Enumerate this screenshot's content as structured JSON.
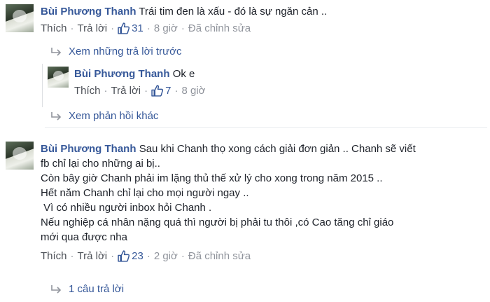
{
  "comments": [
    {
      "author": "Bùi Phương Thanh",
      "lines": [
        "Trái tim đen là xấu - đó là sự ngăn cản .."
      ],
      "meta": {
        "like": "Thích",
        "reply": "Trả lời",
        "likes": "31",
        "time": "8 giờ",
        "edited": "Đã chỉnh sửa"
      }
    },
    {
      "author": "Bùi Phương Thanh",
      "lines": [
        "Ok e"
      ],
      "meta": {
        "like": "Thích",
        "reply": "Trả lời",
        "likes": "7",
        "time": "8 giờ"
      }
    },
    {
      "author": "Bùi Phương Thanh",
      "lines": [
        "Sau khi Chanh thọ xong cách giải đơn giản .. Chanh sẽ viết",
        "fb chỉ lại cho những ai bị..",
        "Còn bây giờ Chanh phải im lặng thủ thế xử lý cho xong trong năm 2015 ..",
        "Hết năm Chanh chỉ lại cho mọi người ngay ..",
        " Vì có nhiều người inbox hỏi Chanh .",
        "Nếu nghiệp cá nhân nặng quá thì người bị phải tu thôi ,có Cao tăng chỉ giáo",
        "mới qua được nha"
      ],
      "meta": {
        "like": "Thích",
        "reply": "Trả lời",
        "likes": "23",
        "time": "2 giờ",
        "edited": "Đã chỉnh sửa"
      }
    }
  ],
  "view_previous_replies": "Xem những trả lời trước",
  "view_more_replies": "Xem phản hồi khác",
  "reply_count": "1 câu trả lời",
  "colors": {
    "link": "#365899",
    "meta": "#90949c",
    "text": "#1d2129"
  },
  "icons": {
    "like": "thumbs-up-icon",
    "arrow": "reply-arrow-icon"
  }
}
